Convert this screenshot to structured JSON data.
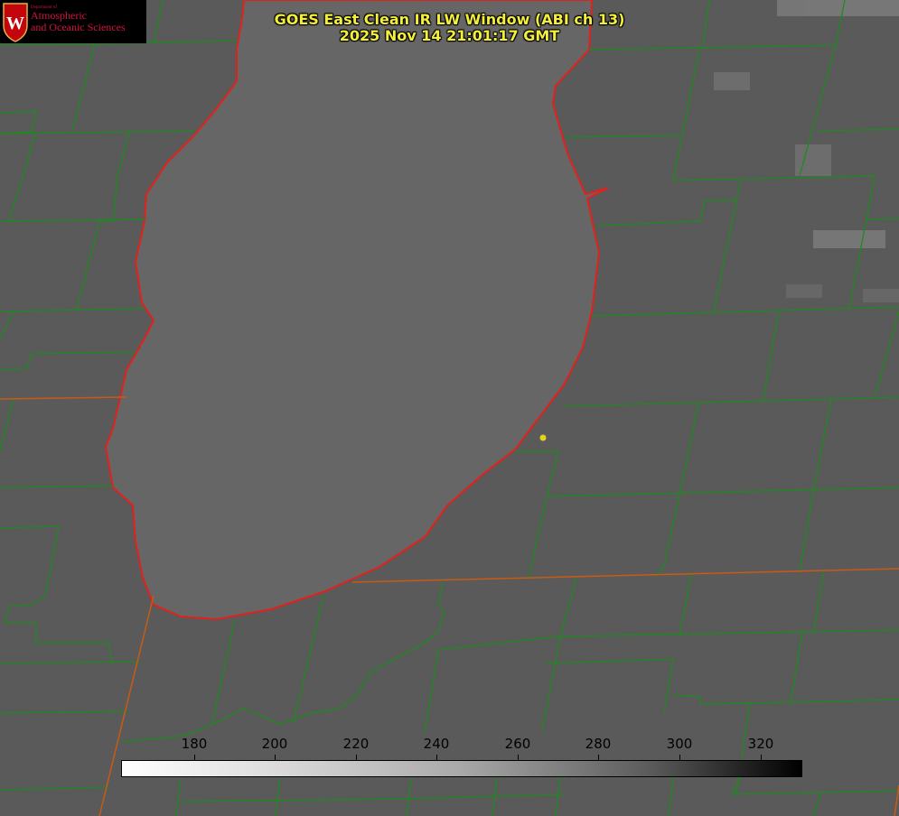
{
  "title": {
    "line1": "GOES East Clean IR LW Window (ABI ch 13)",
    "line2": "2025 Nov 14 21:01:17 GMT"
  },
  "logo": {
    "line_dept": "Department of",
    "line1": "Atmospheric",
    "line2": "and Oceanic Sciences",
    "emblem": "W"
  },
  "colorbar": {
    "ticks": [
      "180",
      "200",
      "220",
      "240",
      "260",
      "280",
      "300",
      "320"
    ],
    "colors": {
      "low": "#ffffff",
      "high": "#000000"
    }
  },
  "colors": {
    "coastline": "#e0221c",
    "county_lines": "#1e8a1e",
    "state_lines": "#c85a14",
    "marker": "#e6d21e",
    "title_text": "#f3ef3a"
  }
}
